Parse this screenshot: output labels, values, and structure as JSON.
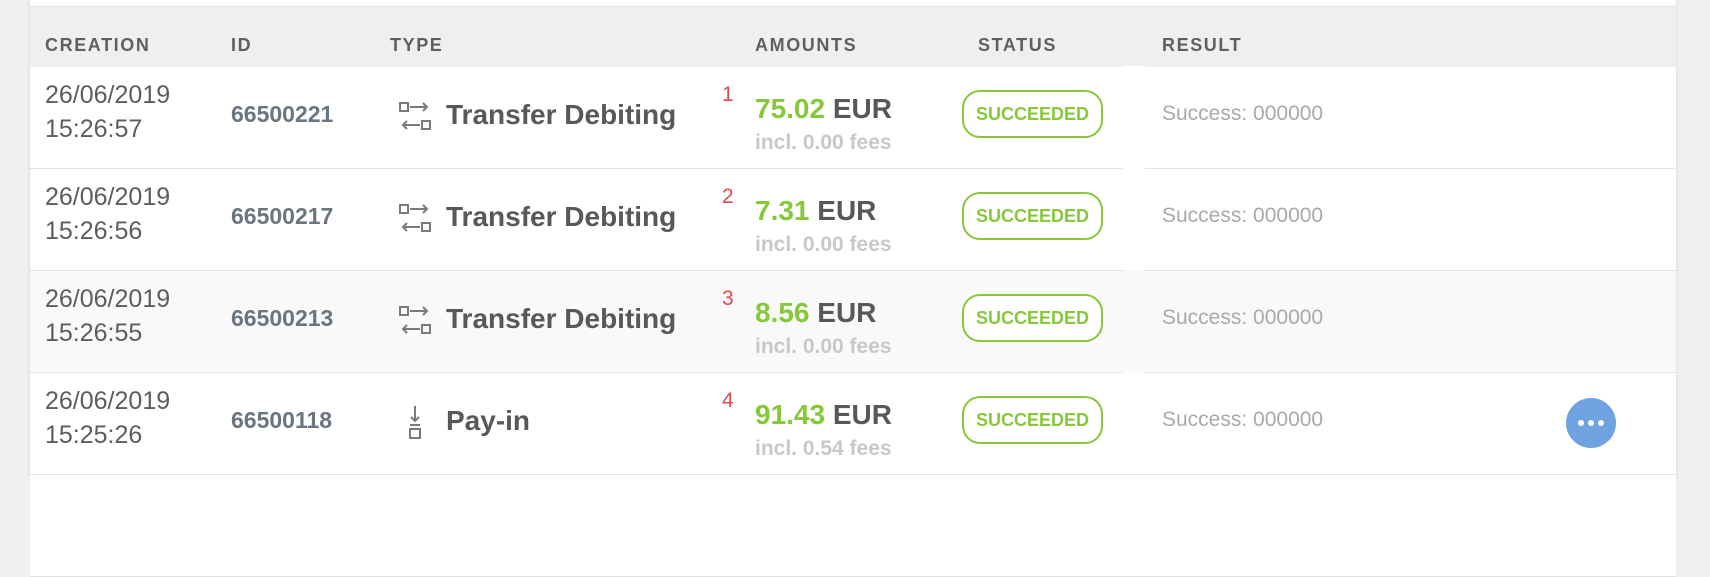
{
  "table": {
    "headers": {
      "creation": "CREATION",
      "id": "ID",
      "type": "TYPE",
      "amounts": "AMOUNTS",
      "status": "STATUS",
      "result": "RESULT"
    },
    "rows": [
      {
        "date": "26/06/2019",
        "time": "15:26:57",
        "id": "66500221",
        "type": "Transfer Debiting",
        "type_icon": "transfer-icon",
        "index": "1",
        "amount": "75.02",
        "currency": "EUR",
        "fees": "incl. 0.00 fees",
        "status": "SUCCEEDED",
        "result": "Success: 000000"
      },
      {
        "date": "26/06/2019",
        "time": "15:26:56",
        "id": "66500217",
        "type": "Transfer Debiting",
        "type_icon": "transfer-icon",
        "index": "2",
        "amount": "7.31",
        "currency": "EUR",
        "fees": "incl. 0.00 fees",
        "status": "SUCCEEDED",
        "result": "Success: 000000"
      },
      {
        "date": "26/06/2019",
        "time": "15:26:55",
        "id": "66500213",
        "type": "Transfer Debiting",
        "type_icon": "transfer-icon",
        "index": "3",
        "amount": "8.56",
        "currency": "EUR",
        "fees": "incl. 0.00 fees",
        "status": "SUCCEEDED",
        "result": "Success: 000000"
      },
      {
        "date": "26/06/2019",
        "time": "15:25:26",
        "id": "66500118",
        "type": "Pay-in",
        "type_icon": "pay-in-icon",
        "index": "4",
        "amount": "91.43",
        "currency": "EUR",
        "fees": "incl. 0.54 fees",
        "status": "SUCCEEDED",
        "result": "Success: 000000"
      }
    ]
  },
  "more_button_icon": "more-dots-icon",
  "colors": {
    "success_green": "#86c83a",
    "index_red": "#e24a4a",
    "accent_blue": "#6fa2e0",
    "header_bg": "#efefef"
  }
}
